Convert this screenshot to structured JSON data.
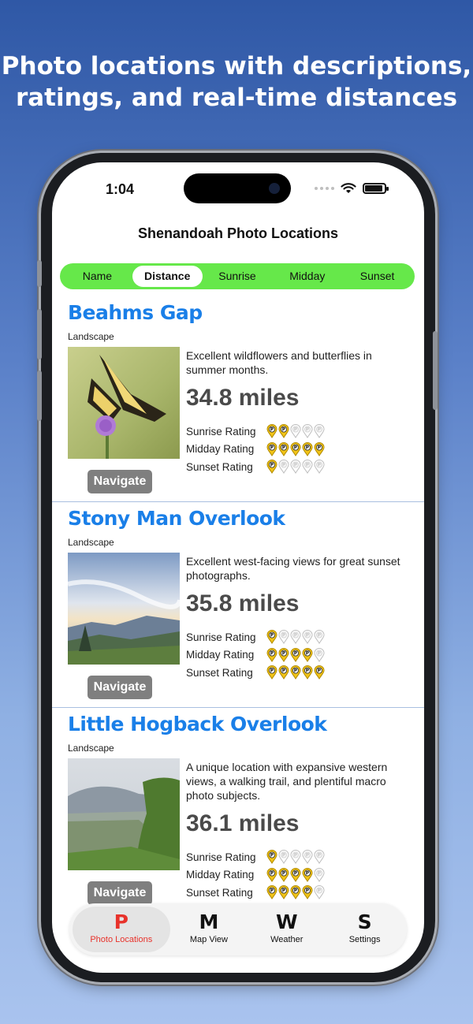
{
  "headline": {
    "line1": "Photo locations with descriptions,",
    "line2": "ratings, and real-time distances"
  },
  "status_bar": {
    "time": "1:04"
  },
  "app": {
    "title": "Shenandoah Photo Locations"
  },
  "sort_tabs": [
    {
      "label": "Name",
      "selected": false
    },
    {
      "label": "Distance",
      "selected": true
    },
    {
      "label": "Sunrise",
      "selected": false
    },
    {
      "label": "Midday",
      "selected": false
    },
    {
      "label": "Sunset",
      "selected": false
    }
  ],
  "locations": [
    {
      "name": "Beahms Gap",
      "type": "Landscape",
      "description": "Excellent wildflowers and butterflies in summer months.",
      "distance": "34.8 miles",
      "navigate_label": "Navigate",
      "ratings": [
        {
          "label": "Sunrise Rating",
          "value": 2
        },
        {
          "label": "Midday Rating",
          "value": 5
        },
        {
          "label": "Sunset Rating",
          "value": 1
        }
      ]
    },
    {
      "name": "Stony Man Overlook",
      "type": "Landscape",
      "description": "Excellent west-facing views for great sunset photographs.",
      "distance": "35.8 miles",
      "navigate_label": "Navigate",
      "ratings": [
        {
          "label": "Sunrise Rating",
          "value": 1
        },
        {
          "label": "Midday Rating",
          "value": 4
        },
        {
          "label": "Sunset Rating",
          "value": 5
        }
      ]
    },
    {
      "name": "Little Hogback Overlook",
      "type": "Landscape",
      "description": "A unique location with expansive western views, a walking trail, and plentiful macro photo subjects.",
      "distance": "36.1 miles",
      "navigate_label": "Navigate",
      "ratings": [
        {
          "label": "Sunrise Rating",
          "value": 1
        },
        {
          "label": "Midday Rating",
          "value": 4
        },
        {
          "label": "Sunset Rating",
          "value": 4
        }
      ]
    }
  ],
  "rating_max": 5,
  "tab_bar": [
    {
      "letter": "P",
      "label": "Photo Locations",
      "active": true
    },
    {
      "letter": "M",
      "label": "Map View",
      "active": false
    },
    {
      "letter": "W",
      "label": "Weather",
      "active": false
    },
    {
      "letter": "S",
      "label": "Settings",
      "active": false
    }
  ],
  "colors": {
    "accent_green": "#66e84a",
    "title_blue": "#1a7fe8",
    "active_tab_red": "#e8322b",
    "pin_gold": "#f2c417"
  }
}
